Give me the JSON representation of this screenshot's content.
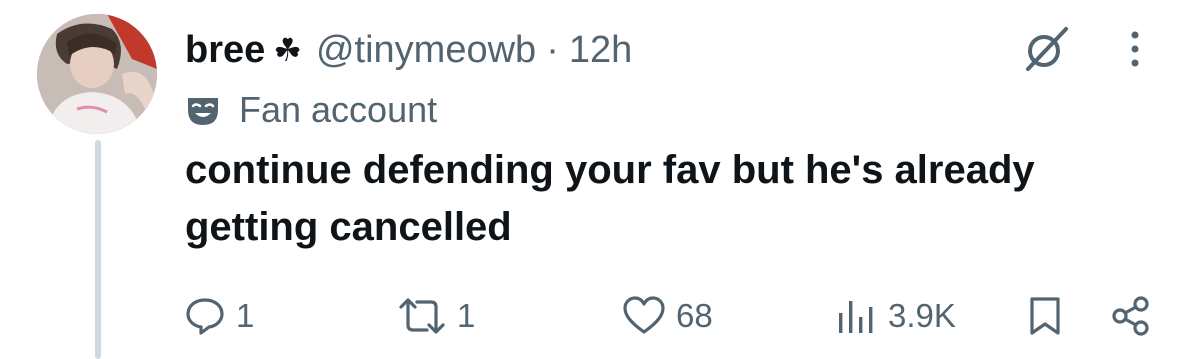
{
  "post": {
    "author_name": "bree",
    "author_badge": "☘",
    "handle": "@tinymeowb",
    "separator": "·",
    "time": "12h",
    "label": "Fan account",
    "text_line1": "continue defending your fav but he's already",
    "text_line2": "getting cancelled"
  },
  "actions": {
    "replies": "1",
    "reposts": "1",
    "likes": "68",
    "views": "3.9K"
  },
  "colors": {
    "text": "#0f1419",
    "secondary": "#536471",
    "thread_line": "#cfd9de",
    "background": "#ffffff"
  },
  "icons": [
    "grok-icon",
    "more-icon",
    "fan-account-mask-icon",
    "reply-icon",
    "repost-icon",
    "like-icon",
    "views-icon",
    "bookmark-icon",
    "share-icon"
  ]
}
